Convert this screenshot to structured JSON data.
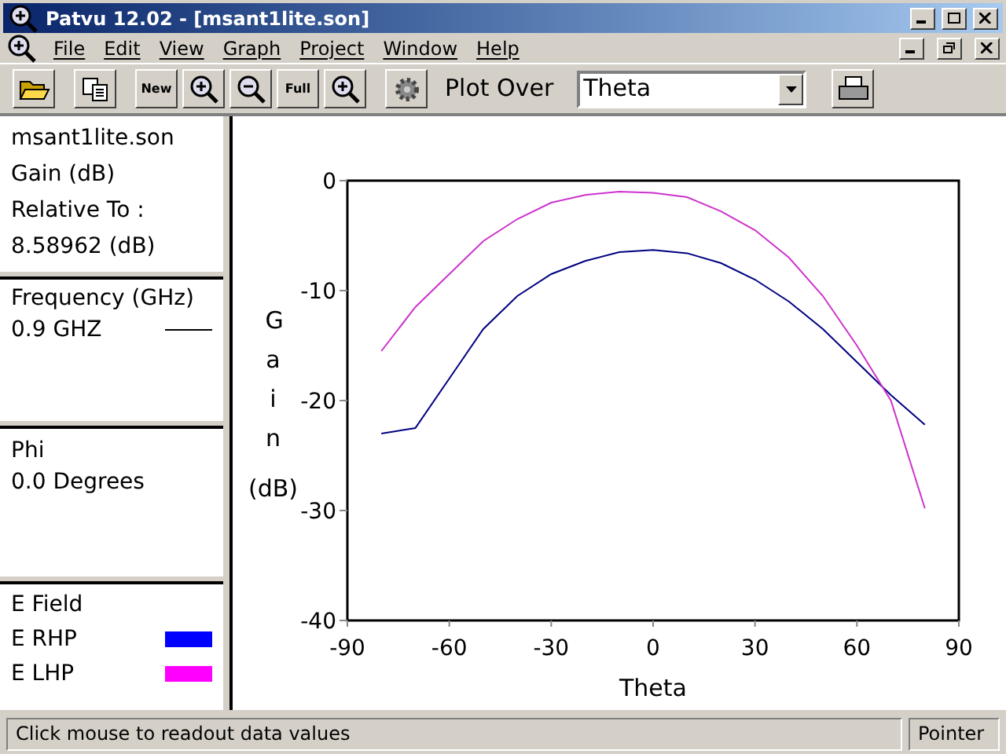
{
  "window": {
    "title": "Patvu 12.02 - [msant1lite.son]"
  },
  "menu": [
    {
      "label": "File"
    },
    {
      "label": "Edit"
    },
    {
      "label": "View"
    },
    {
      "label": "Graph"
    },
    {
      "label": "Project"
    },
    {
      "label": "Window"
    },
    {
      "label": "Help"
    }
  ],
  "toolbar": {
    "left": [
      {
        "kind": "open"
      },
      {
        "kind": "copy"
      },
      {
        "kind": "new",
        "label": "New"
      },
      {
        "kind": "zoom-in"
      },
      {
        "kind": "zoom-out"
      },
      {
        "kind": "full",
        "label": "Full"
      },
      {
        "kind": "zoom-custom"
      },
      {
        "kind": "gear"
      }
    ],
    "plot_over_label": "Plot Over",
    "plot_over_value": "Theta"
  },
  "info": {
    "file": "msant1lite.son",
    "quantity": "Gain (dB)",
    "relative_label": "Relative To :",
    "relative_value": "8.58962 (dB)"
  },
  "frequency": {
    "title": "Frequency (GHz)",
    "items": [
      {
        "label": "0.9 GHZ"
      }
    ]
  },
  "phi": {
    "title": "Phi",
    "items": [
      "0.0 Degrees"
    ]
  },
  "legend": {
    "title": "E Field",
    "items": [
      {
        "label": "E RHP",
        "color": "#0000ff"
      },
      {
        "label": "E LHP",
        "color": "#ff00ff"
      }
    ]
  },
  "chart_data": {
    "type": "line",
    "xlabel": "Theta",
    "ylabel": "Gain (dB)",
    "x": [
      -80,
      -70,
      -60,
      -50,
      -40,
      -30,
      -20,
      -10,
      0,
      10,
      20,
      30,
      40,
      50,
      60,
      70,
      80
    ],
    "xlim": [
      -90,
      90
    ],
    "ylim": [
      -40,
      0
    ],
    "xticks": [
      -90,
      -60,
      -30,
      0,
      30,
      60,
      90
    ],
    "yticks": [
      -40,
      -30,
      -20,
      -10,
      0
    ],
    "series": [
      {
        "color": "#000080",
        "values": [
          -23,
          -22.5,
          -18,
          -13.5,
          -10.5,
          -8.5,
          -7.3,
          -6.5,
          -6.3,
          -6.6,
          -7.5,
          -9,
          -11,
          -13.5,
          -16.5,
          -19.5,
          -22.2
        ]
      },
      {
        "color": "#cc33cc",
        "values": [
          -15.5,
          -11.5,
          -8.5,
          -5.5,
          -3.5,
          -2,
          -1.3,
          -1,
          -1.1,
          -1.5,
          -2.8,
          -4.5,
          -7,
          -10.5,
          -15,
          -20,
          -29.8
        ]
      }
    ]
  },
  "status_bar": {
    "message": "Click mouse to readout data values",
    "mode": "Pointer"
  }
}
